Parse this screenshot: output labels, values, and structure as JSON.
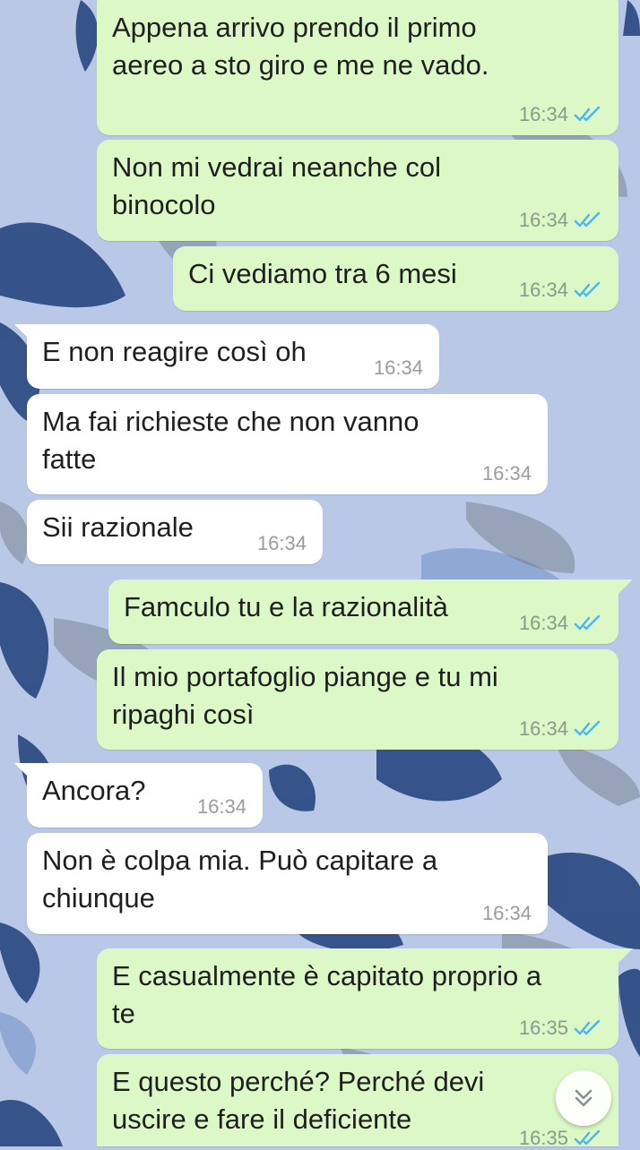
{
  "theme": {
    "outgoing_bubble": "#dcf8c6",
    "incoming_bubble": "#ffffff",
    "read_ticks": "#4fb6ec",
    "wallpaper": "#b9c8e6"
  },
  "messages": [
    {
      "direction": "outgoing",
      "text": "Appena arrivo prendo il primo\naereo a sto giro e me ne vado.",
      "time": "16:34",
      "status": "read"
    },
    {
      "direction": "outgoing",
      "text": "Non mi vedrai neanche col\nbinocolo",
      "time": "16:34",
      "status": "read"
    },
    {
      "direction": "outgoing",
      "text": "Ci vediamo tra 6 mesi",
      "time": "16:34",
      "status": "read"
    },
    {
      "direction": "incoming",
      "text": "E non reagire così oh",
      "time": "16:34"
    },
    {
      "direction": "incoming",
      "text": "Ma fai richieste che non vanno\nfatte",
      "time": "16:34"
    },
    {
      "direction": "incoming",
      "text": "Sii razionale",
      "time": "16:34"
    },
    {
      "direction": "outgoing",
      "text": "Famculo tu e la razionalità",
      "time": "16:34",
      "status": "read"
    },
    {
      "direction": "outgoing",
      "text": "Il mio portafoglio piange e tu mi\nripaghi così",
      "time": "16:34",
      "status": "read"
    },
    {
      "direction": "incoming",
      "text": "Ancora?",
      "time": "16:34"
    },
    {
      "direction": "incoming",
      "text": "Non è colpa mia. Può capitare a\nchiunque",
      "time": "16:34"
    },
    {
      "direction": "outgoing",
      "text": "E casualmente è capitato proprio a\nte",
      "time": "16:35",
      "status": "read"
    },
    {
      "direction": "outgoing",
      "text": "E questo perché? Perché devi\nuscire e fare il deficiente",
      "time": "16:35",
      "status": "read"
    }
  ],
  "scroll_button": {
    "icon": "chevron-double-down-icon"
  }
}
